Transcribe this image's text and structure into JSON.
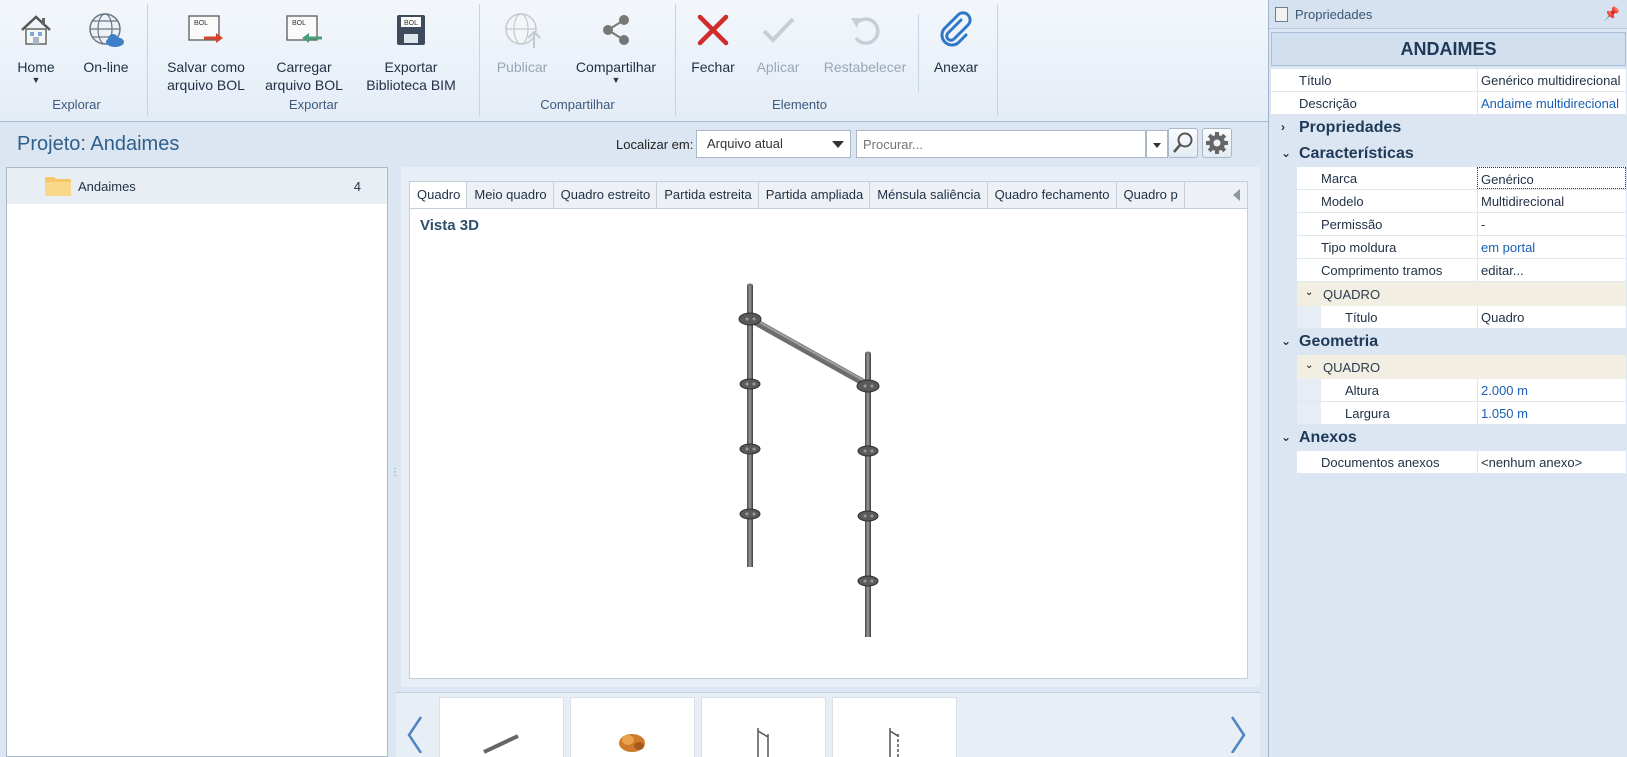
{
  "ribbon": {
    "groups": [
      {
        "label": "Explorar",
        "buttons": [
          {
            "label": "Home",
            "icon": "house-icon"
          },
          {
            "label": "On-line",
            "icon": "globe-icon"
          }
        ]
      },
      {
        "label": "Exportar",
        "buttons": [
          {
            "label": "Salvar como arquivo BOL",
            "icon": "bol-save-icon"
          },
          {
            "label": "Carregar arquivo BOL",
            "icon": "bol-load-icon"
          },
          {
            "label": "Exportar Biblioteca BIM",
            "icon": "bol-export-icon"
          }
        ]
      },
      {
        "label": "Compartilhar",
        "buttons": [
          {
            "label": "Publicar",
            "icon": "publish-globe-icon"
          },
          {
            "label": "Compartilhar",
            "icon": "share-icon"
          }
        ]
      },
      {
        "label": "Elemento",
        "buttons": [
          {
            "label": "Fechar",
            "icon": "close-x-icon"
          },
          {
            "label": "Aplicar",
            "icon": "check-icon"
          },
          {
            "label": "Restabelecer",
            "icon": "undo-icon"
          },
          {
            "label": "Anexar",
            "icon": "paperclip-icon"
          }
        ]
      }
    ],
    "bol_tag": "BOL"
  },
  "project": {
    "title": "Projeto: Andaimes",
    "locate_label": "Localizar em:",
    "locate_value": "Arquivo atual",
    "search_placeholder": "Procurar..."
  },
  "tree": {
    "items": [
      {
        "label": "Andaimes",
        "count": "4"
      }
    ]
  },
  "viewer": {
    "tabs": [
      "Quadro",
      "Meio quadro",
      "Quadro estreito",
      "Partida estreita",
      "Partida ampliada",
      "Ménsula saliência",
      "Quadro fechamento",
      "Quadro p"
    ],
    "active_tab": "Quadro",
    "view_title": "Vista 3D"
  },
  "properties": {
    "panel_title": "Propriedades",
    "banner": "ANDAIMES",
    "top_rows": [
      {
        "key": "Título",
        "value": "Genérico multidirecional"
      },
      {
        "key": "Descrição",
        "value": "Andaime multidirecional"
      }
    ],
    "sections": {
      "propriedades": "Propriedades",
      "caracteristicas": "Características",
      "geometria": "Geometria",
      "anexos": "Anexos"
    },
    "caracteristicas_rows": [
      {
        "key": "Marca",
        "value": "Genérico"
      },
      {
        "key": "Modelo",
        "value": "Multidirecional"
      },
      {
        "key": "Permissão",
        "value": "-"
      },
      {
        "key": "Tipo moldura",
        "value": "em portal"
      },
      {
        "key": "Comprimento tramos",
        "value": "editar..."
      }
    ],
    "quadro_sub_label": "QUADRO",
    "quadro_title_row": {
      "key": "Título",
      "value": "Quadro"
    },
    "geometria_sub_label": "QUADRO",
    "geometria_rows": [
      {
        "key": "Altura",
        "value": "2.000 m"
      },
      {
        "key": "Largura",
        "value": "1.050 m"
      }
    ],
    "anexos_row": {
      "key": "Documentos anexos",
      "value": "<nenhum anexo>"
    }
  },
  "colors": {
    "accent": "#2f5f8a",
    "link": "#1a5fb4",
    "close_red": "#d12b2b",
    "attach_blue": "#2f77c7"
  }
}
